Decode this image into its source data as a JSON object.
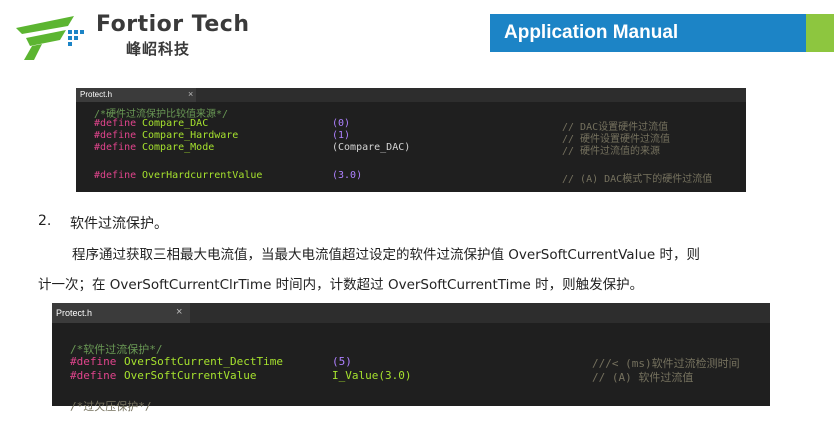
{
  "header": {
    "brand_en": "Fortior Tech",
    "brand_cn": "峰岹科技",
    "banner": "Application Manual",
    "colors": {
      "banner": "#1c84c6",
      "accent": "#8dc63f",
      "logo_green": "#5cb531",
      "logo_blue": "#1c84c6"
    }
  },
  "panel1": {
    "tab_name": "Protect.h",
    "tab_close": "×",
    "comment": "/*硬件过流保护比较值来源*/",
    "lines": [
      {
        "kw": "#define",
        "name": "Compare_DAC",
        "value": "(0)",
        "comment": "// DAC设置硬件过流值"
      },
      {
        "kw": "#define",
        "name": "Compare_Hardware",
        "value": "(1)",
        "comment": "// 硬件设置硬件过流值"
      },
      {
        "kw": "#define",
        "name": "Compare_Mode",
        "value": "(Compare_DAC)",
        "comment": "// 硬件过流值的来源"
      },
      {
        "kw": "#define",
        "name": "OverHardcurrentValue",
        "value": "(3.0)",
        "comment": "// (A) DAC模式下的硬件过流值"
      }
    ]
  },
  "section": {
    "number": "2.",
    "heading": "软件过流保护。",
    "para_line1": "程序通过获取三相最大电流值，当最大电流值超过设定的软件过流保护值 OverSoftCurrentValue 时，则",
    "para_line2": "计一次；在 OverSoftCurrentClrTime 时间内，计数超过 OverSoftCurrentTime 时，则触发保护。"
  },
  "panel2": {
    "tab_name": "Protect.h",
    "tab_close": "×",
    "comment": "/*软件过流保护*/",
    "lines": [
      {
        "kw": "#define",
        "name": "OverSoftCurrent_DectTime",
        "value": "(5)",
        "comment": "///< (ms)软件过流检测时间"
      },
      {
        "kw": "#define",
        "name": "OverSoftCurrentValue",
        "value": "I_Value(3.0)",
        "comment": "// (A) 软件过流值"
      }
    ],
    "cut_comment": "/*过欠压保护*/"
  }
}
